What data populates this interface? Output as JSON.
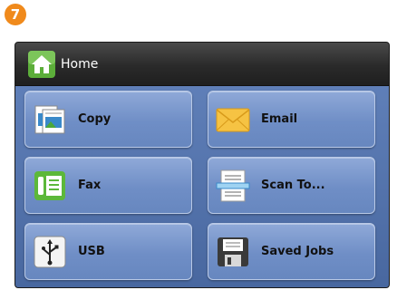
{
  "step_badge": "7",
  "header": {
    "title": "Home",
    "icon": "home-icon"
  },
  "tiles": [
    {
      "label": "Copy",
      "icon": "copy-icon"
    },
    {
      "label": "Email",
      "icon": "email-icon"
    },
    {
      "label": "Fax",
      "icon": "fax-icon"
    },
    {
      "label": "Scan To...",
      "icon": "scan-icon"
    },
    {
      "label": "USB",
      "icon": "usb-icon"
    },
    {
      "label": "Saved Jobs",
      "icon": "saved-jobs-icon"
    }
  ],
  "colors": {
    "badge": "#f08a1c",
    "title_bar": "#2a2a2a",
    "panel": "#5f7fb8",
    "tile": "#7f9ccf"
  }
}
